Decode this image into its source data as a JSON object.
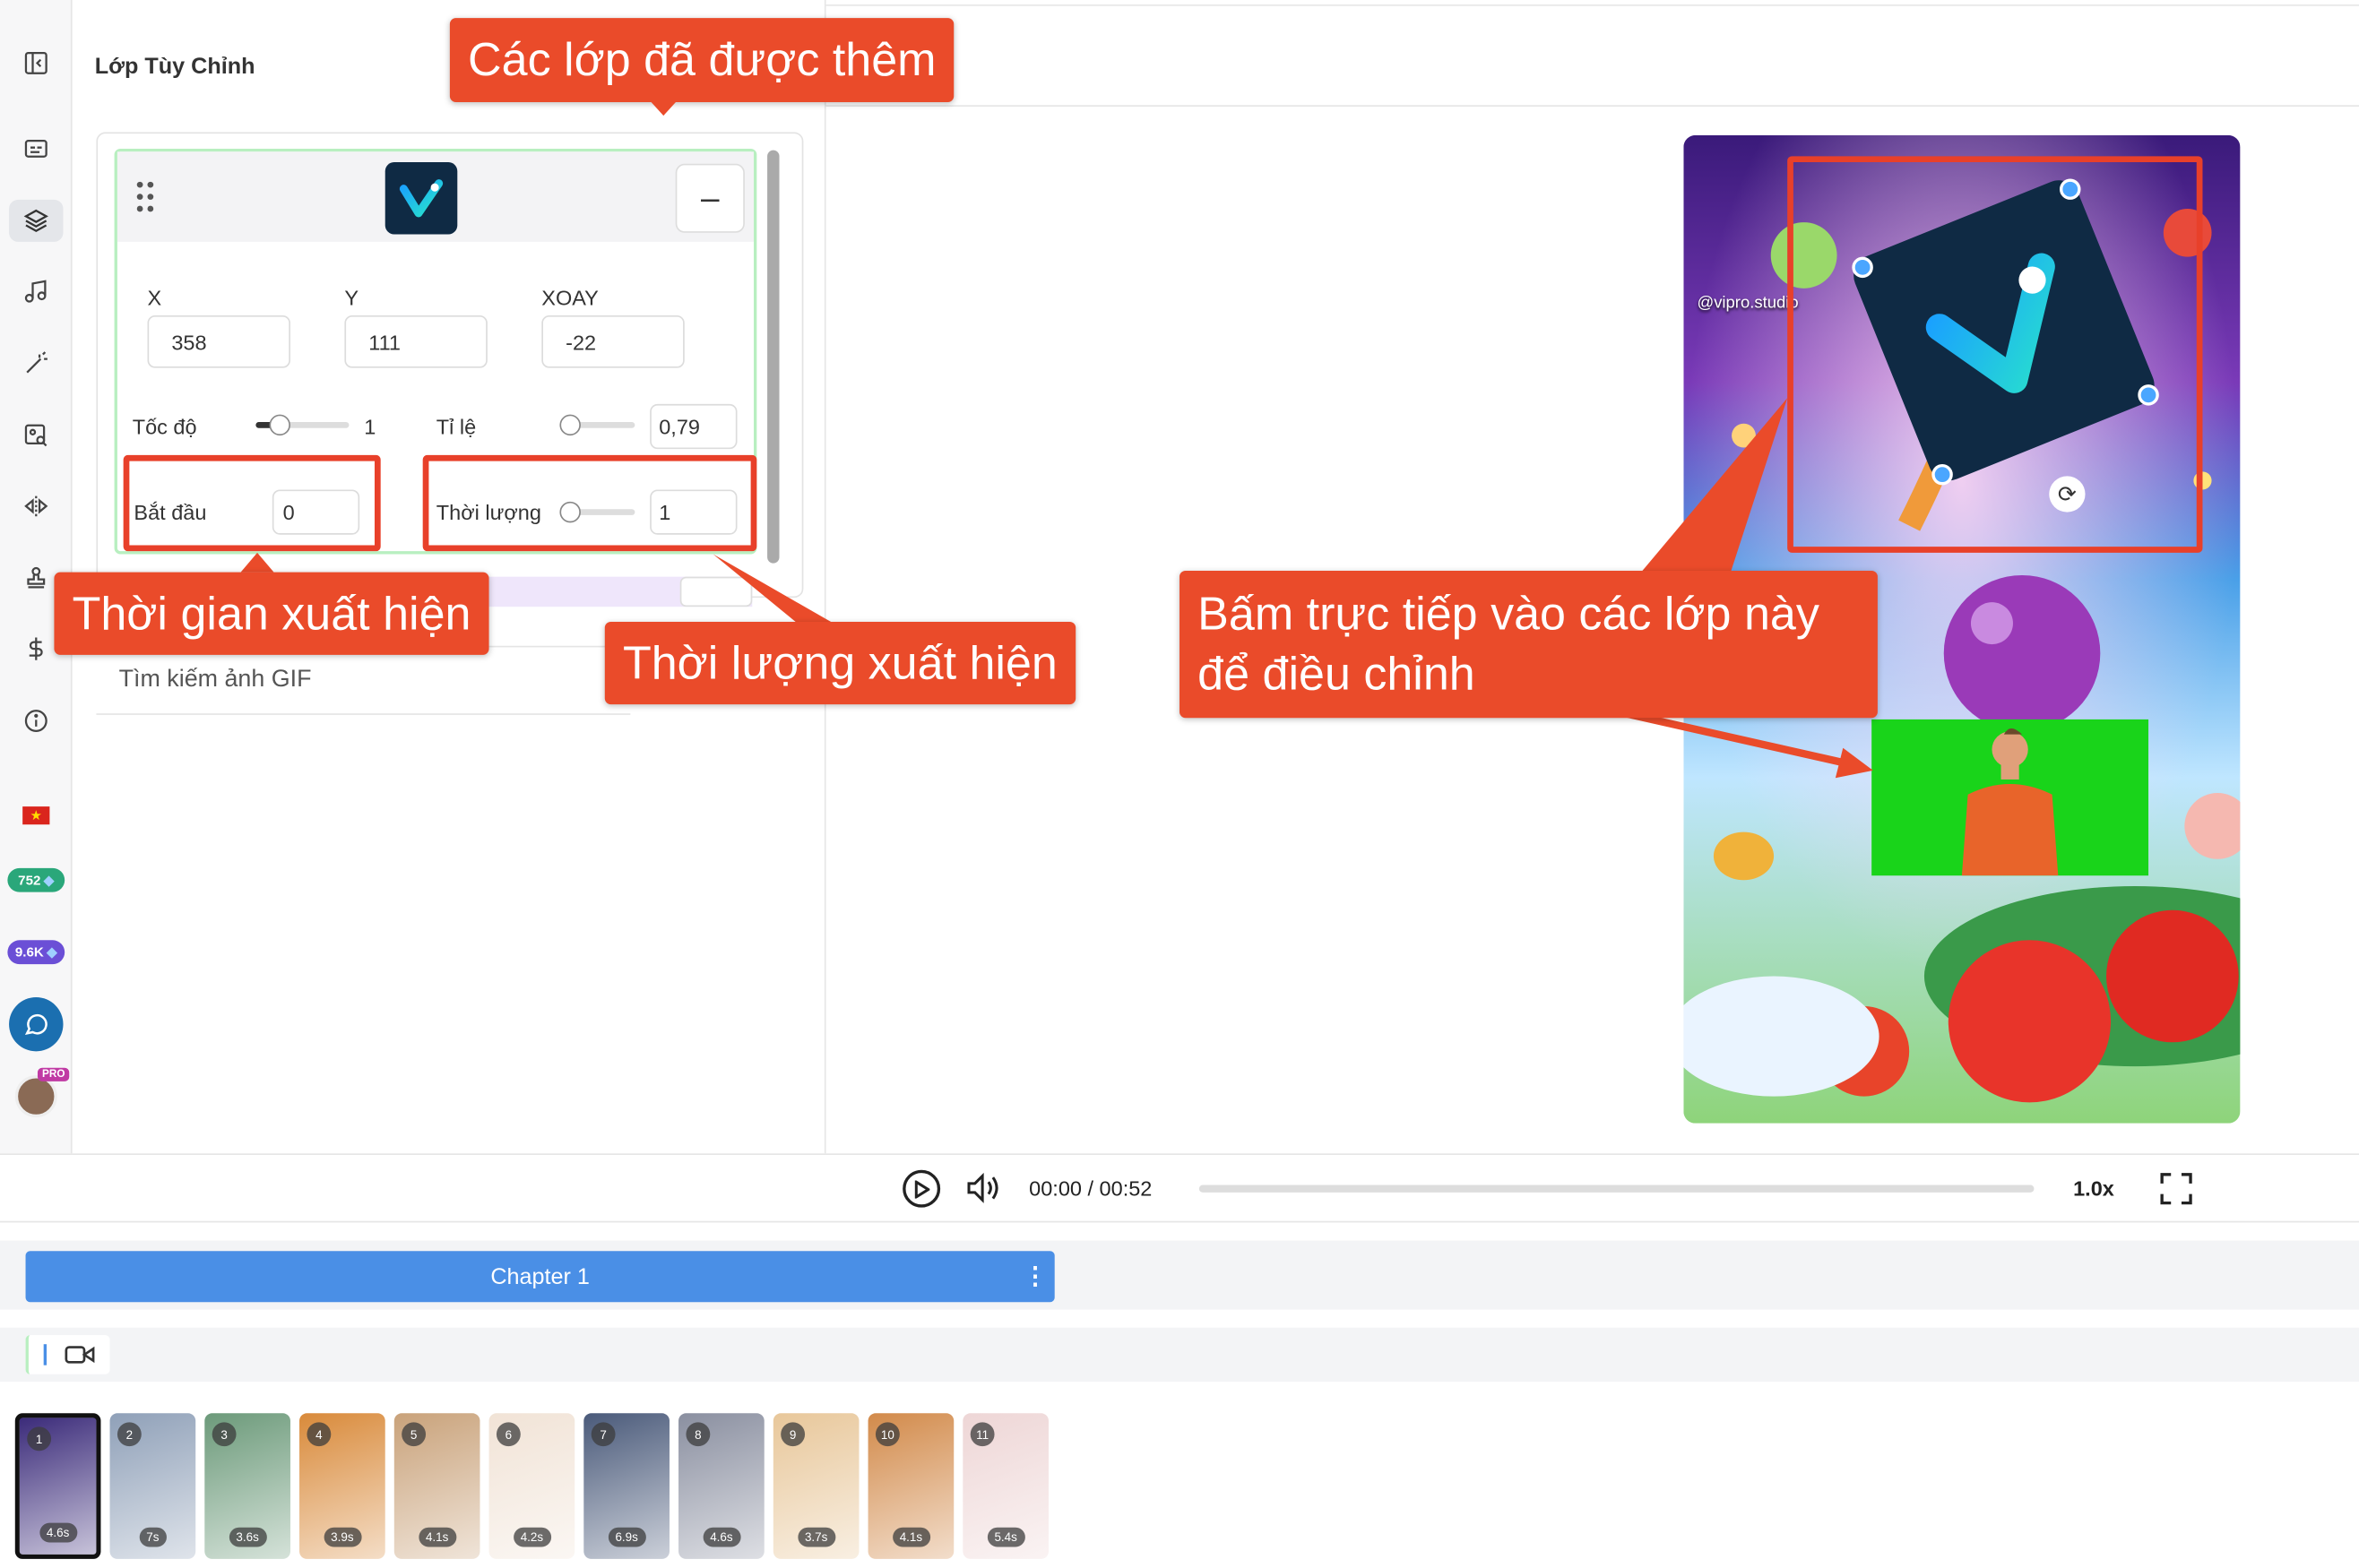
{
  "panel": {
    "title": "Lớp Tùy Chỉnh",
    "fields": {
      "x_label": "X",
      "x_value": "358",
      "y_label": "Y",
      "y_value": "111",
      "rot_label": "XOAY",
      "rot_value": "-22",
      "speed_label": "Tốc độ",
      "speed_value": "1",
      "scale_label": "Tỉ lệ",
      "scale_value": "0,79",
      "start_label": "Bắt đầu",
      "start_value": "0",
      "duration_label": "Thời lượng",
      "duration_value": "1"
    },
    "search_placeholder": "Tìm kiếm ảnh GIF",
    "minus": "–"
  },
  "callouts": {
    "added_layers": "Các lớp đã được thêm",
    "appear_time": "Thời gian xuất hiện",
    "appear_duration": "Thời lượng xuất hiện",
    "click_layers_line1": "Bấm trực tiếp vào các lớp này",
    "click_layers_line2": "để điều chỉnh"
  },
  "preview": {
    "watermark": "@vipro.studio"
  },
  "sidebar": {
    "credits_1": "752",
    "credits_2": "9.6K",
    "pro_badge": "PRO"
  },
  "player": {
    "time": "00:00 / 00:52",
    "speed": "1.0x",
    "progress": 0
  },
  "timeline": {
    "chapter_label": "Chapter 1",
    "chapter_menu": "⋮"
  },
  "scenes": [
    {
      "num": "1",
      "dur": "4.6s",
      "color": "#3b2b7a"
    },
    {
      "num": "2",
      "dur": "7s",
      "color": "#8fa0b8"
    },
    {
      "num": "3",
      "dur": "3.6s",
      "color": "#6c9a7a"
    },
    {
      "num": "4",
      "dur": "3.9s",
      "color": "#d98a3a"
    },
    {
      "num": "5",
      "dur": "4.1s",
      "color": "#c9a27a"
    },
    {
      "num": "6",
      "dur": "4.2s",
      "color": "#f1e3d6"
    },
    {
      "num": "7",
      "dur": "6.9s",
      "color": "#4a5a7a"
    },
    {
      "num": "8",
      "dur": "4.6s",
      "color": "#8a8fa0"
    },
    {
      "num": "9",
      "dur": "3.7s",
      "color": "#e8c79a"
    },
    {
      "num": "10",
      "dur": "4.1s",
      "color": "#d28a4a"
    },
    {
      "num": "11",
      "dur": "5.4s",
      "color": "#eed6d6"
    }
  ]
}
